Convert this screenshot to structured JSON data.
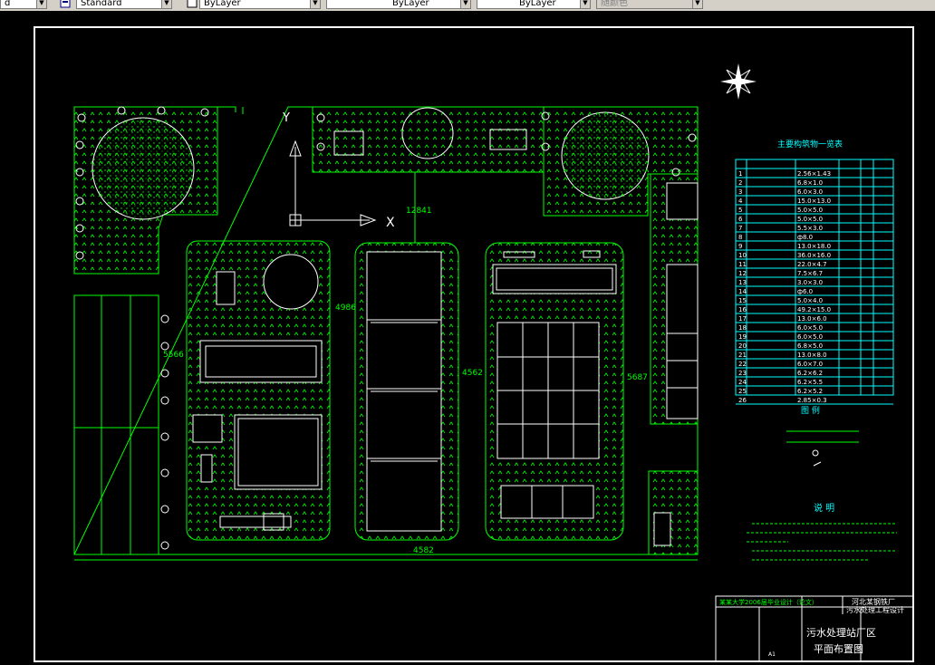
{
  "toolbar": {
    "field0_text": "d",
    "text_style": "Standard",
    "layer1": "ByLayer",
    "layer2": "ByLayer",
    "layer3": "ByLayer",
    "color": "随颜色"
  },
  "colors": {
    "frame": "#ffffff",
    "linework": "#00ff00",
    "table": "#00ffff",
    "title_red": "#ff0000",
    "text": "#ffffff"
  },
  "drawing": {
    "axis_y": "Y",
    "axis_x": "X",
    "dim_top": "12841",
    "dim_left": "5566",
    "dim_mid1": "4986",
    "dim_mid2": "4562",
    "dim_right": "5687",
    "dim_bottom": "4582"
  },
  "table": {
    "title": "主要构筑物一览表",
    "rows": [
      {
        "no": "1",
        "size": "2.56×1.43"
      },
      {
        "no": "2",
        "size": "6.8×1.0"
      },
      {
        "no": "3",
        "size": "6.0×3.0"
      },
      {
        "no": "4",
        "size": "15.0×13.0"
      },
      {
        "no": "5",
        "size": "5.0×5.0"
      },
      {
        "no": "6",
        "size": "5.0×5.0"
      },
      {
        "no": "7",
        "size": "5.5×3.0"
      },
      {
        "no": "8",
        "size": "ф8.0"
      },
      {
        "no": "9",
        "size": "13.0×18.0"
      },
      {
        "no": "10",
        "size": "36.0×16.0"
      },
      {
        "no": "11",
        "size": "22.0×4.7"
      },
      {
        "no": "12",
        "size": "7.5×6.7"
      },
      {
        "no": "13",
        "size": "3.0×3.0"
      },
      {
        "no": "14",
        "size": "ф6.0"
      },
      {
        "no": "15",
        "size": "5.0×4.0"
      },
      {
        "no": "16",
        "size": "49.2×15.0"
      },
      {
        "no": "17",
        "size": "13.0×6.0"
      },
      {
        "no": "18",
        "size": "6.0×5.0"
      },
      {
        "no": "19",
        "size": "6.0×5.0"
      },
      {
        "no": "20",
        "size": "6.8×5.0"
      },
      {
        "no": "21",
        "size": "13.0×8.0"
      },
      {
        "no": "22",
        "size": "6.0×7.0"
      },
      {
        "no": "23",
        "size": "6.2×6.2"
      },
      {
        "no": "24",
        "size": "6.2×5.5"
      },
      {
        "no": "25",
        "size": "6.2×5.2"
      },
      {
        "no": "26",
        "size": "2.85×0.3"
      }
    ]
  },
  "legend": {
    "title": "图  例"
  },
  "notes": {
    "title": "说  明"
  },
  "title_block": {
    "project_line1": "河北某钢铁厂",
    "project_line2": "污水处理工程设计",
    "drawing_title1": "污水处理站厂区",
    "drawing_title2": "平面布置图",
    "school": "某某大学2006届毕业设计（论文）",
    "scale_tag": "A1"
  }
}
